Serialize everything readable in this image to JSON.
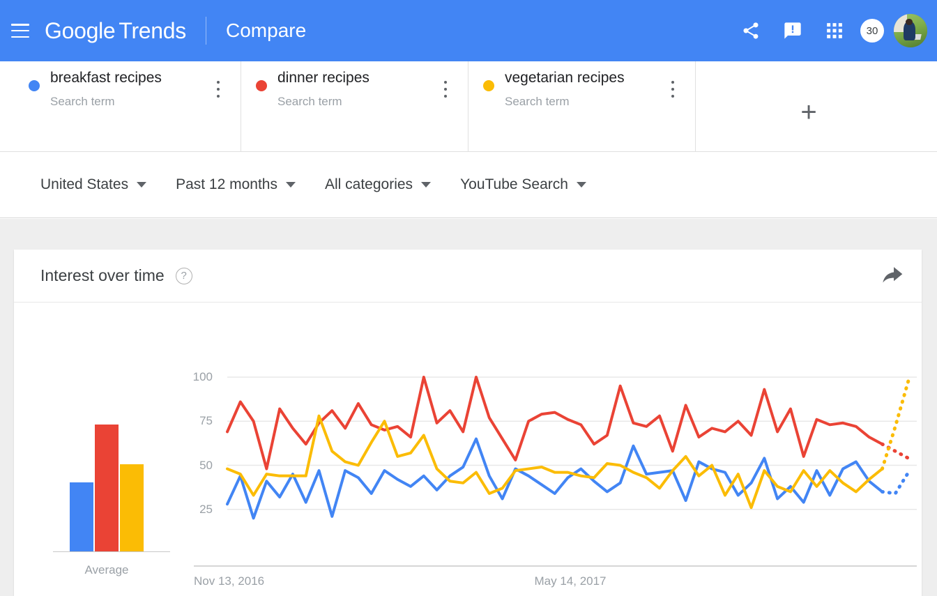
{
  "header": {
    "menu_icon": "hamburger-menu-icon",
    "brand_google": "Google",
    "brand_trends": "Trends",
    "page_title": "Compare",
    "share_icon": "share-icon",
    "feedback_icon": "feedback-icon",
    "apps_icon": "apps-grid-icon",
    "notification_count": "30",
    "avatar": "user-avatar"
  },
  "terms": [
    {
      "name": "breakfast recipes",
      "type": "Search term",
      "color": "#4285f4"
    },
    {
      "name": "dinner recipes",
      "type": "Search term",
      "color": "#ea4335"
    },
    {
      "name": "vegetarian recipes",
      "type": "Search term",
      "color": "#fbbc05"
    }
  ],
  "add_term": {
    "label": "+"
  },
  "filters": [
    {
      "label": "United States"
    },
    {
      "label": "Past 12 months"
    },
    {
      "label": "All categories"
    },
    {
      "label": "YouTube Search"
    }
  ],
  "card": {
    "title": "Interest over time",
    "help": "?",
    "export_icon": "export-share-icon"
  },
  "average": {
    "label": "Average",
    "values": [
      38,
      70,
      48
    ]
  },
  "chart_data": {
    "type": "line",
    "title": "Interest over time",
    "xlabel": "",
    "ylabel": "",
    "ylim": [
      0,
      100
    ],
    "yticks": [
      25,
      50,
      75,
      100
    ],
    "xticks": [
      "Nov 13, 2016",
      "May 14, 2017"
    ],
    "xtick_positions": [
      0,
      26
    ],
    "grid": true,
    "legend": "top-cards",
    "n_points": 53,
    "partial_from": 50,
    "note": "Last segment rendered dotted (partial data)",
    "series": [
      {
        "name": "breakfast recipes",
        "color": "#4285f4",
        "values": [
          28,
          44,
          20,
          41,
          32,
          45,
          29,
          47,
          21,
          47,
          43,
          34,
          47,
          42,
          38,
          44,
          36,
          44,
          49,
          65,
          44,
          31,
          48,
          44,
          39,
          34,
          43,
          48,
          41,
          35,
          40,
          61,
          45,
          46,
          47,
          30,
          52,
          48,
          46,
          33,
          40,
          54,
          31,
          38,
          29,
          47,
          33,
          48,
          52,
          41,
          35,
          34,
          46
        ]
      },
      {
        "name": "dinner recipes",
        "color": "#ea4335",
        "values": [
          69,
          86,
          75,
          48,
          82,
          71,
          62,
          74,
          81,
          71,
          85,
          73,
          70,
          72,
          66,
          100,
          74,
          81,
          69,
          100,
          77,
          65,
          53,
          75,
          79,
          80,
          76,
          73,
          62,
          67,
          95,
          74,
          72,
          78,
          58,
          84,
          66,
          71,
          69,
          75,
          67,
          93,
          69,
          82,
          55,
          76,
          73,
          74,
          72,
          66,
          62,
          58,
          54
        ]
      },
      {
        "name": "vegetarian recipes",
        "color": "#fbbc05",
        "values": [
          48,
          45,
          33,
          45,
          44,
          44,
          44,
          78,
          58,
          52,
          50,
          63,
          75,
          55,
          57,
          67,
          48,
          41,
          40,
          46,
          34,
          37,
          47,
          48,
          49,
          46,
          46,
          44,
          43,
          51,
          50,
          46,
          43,
          37,
          47,
          55,
          44,
          50,
          33,
          45,
          26,
          47,
          38,
          35,
          47,
          38,
          47,
          40,
          35,
          42,
          48,
          72,
          98
        ]
      }
    ]
  }
}
